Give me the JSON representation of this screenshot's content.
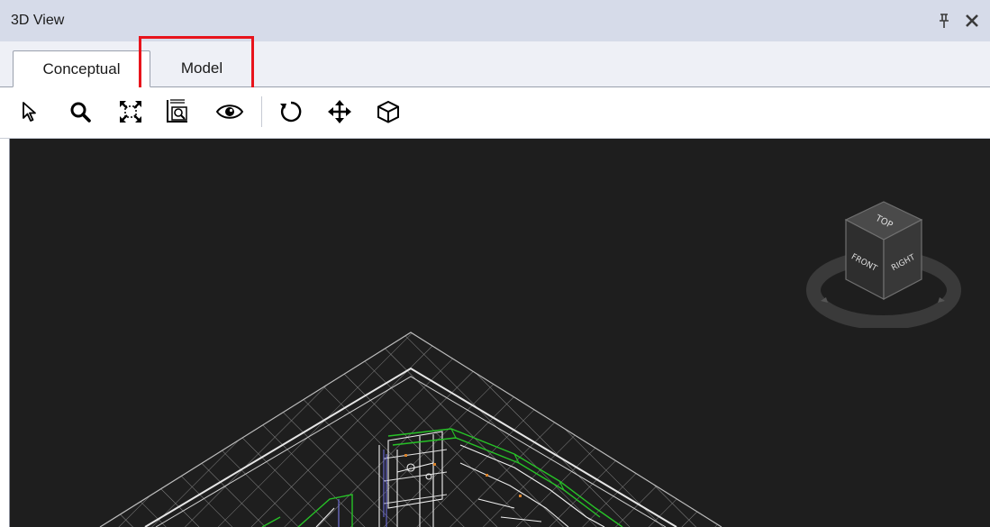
{
  "panel": {
    "title": "3D View",
    "pin_icon": "pin-icon",
    "close_icon": "close-icon"
  },
  "tabs": [
    {
      "label": "Conceptual",
      "active": true
    },
    {
      "label": "Model",
      "active": false
    }
  ],
  "highlight": {
    "target": "Model",
    "color": "#e8141c"
  },
  "toolbar": {
    "tools": [
      {
        "name": "select-tool",
        "icon": "arrow-cursor-icon"
      },
      {
        "name": "zoom-tool",
        "icon": "magnifier-icon"
      },
      {
        "name": "zoom-extents-tool",
        "icon": "zoom-extents-icon"
      },
      {
        "name": "zoom-window-tool",
        "icon": "zoom-window-icon"
      },
      {
        "name": "visibility-tool",
        "icon": "eye-icon"
      },
      {
        "name": "orbit-tool",
        "icon": "orbit-icon"
      },
      {
        "name": "pan-tool",
        "icon": "pan-arrows-icon"
      },
      {
        "name": "view-cube-tool",
        "icon": "cube-icon"
      }
    ]
  },
  "viewport": {
    "background": "#1e1e1e",
    "viewcube": {
      "top": "TOP",
      "front": "FRONT",
      "right": "RIGHT"
    }
  }
}
